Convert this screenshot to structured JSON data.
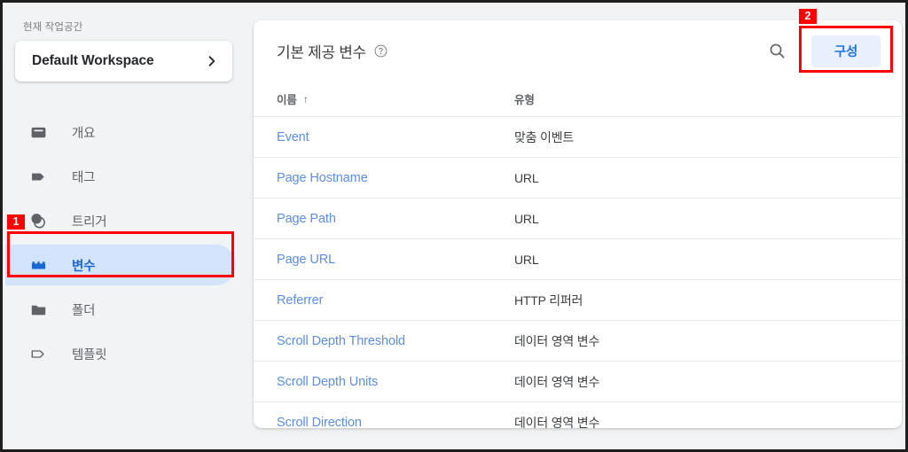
{
  "sidebar": {
    "workspace_label": "현재 작업공간",
    "workspace_name": "Default Workspace",
    "chevron_icon": "chevron-right-icon",
    "items": [
      {
        "label": "개요",
        "icon": "overview-inbox-icon",
        "selected": false
      },
      {
        "label": "태그",
        "icon": "tag-icon",
        "selected": false
      },
      {
        "label": "트리거",
        "icon": "trigger-circles-icon",
        "selected": false
      },
      {
        "label": "변수",
        "icon": "variable-block-icon",
        "selected": true
      },
      {
        "label": "폴더",
        "icon": "folder-icon",
        "selected": false
      },
      {
        "label": "템플릿",
        "icon": "template-tag-outline-icon",
        "selected": false
      }
    ]
  },
  "main": {
    "title": "기본 제공 변수",
    "help_icon": "help-circle-icon",
    "search_icon": "search-icon",
    "configure_label": "구성",
    "columns": {
      "name": "이름",
      "sort_arrow": "↑",
      "type": "유형"
    },
    "rows": [
      {
        "name": "Event",
        "type": "맞춤 이벤트"
      },
      {
        "name": "Page Hostname",
        "type": "URL"
      },
      {
        "name": "Page Path",
        "type": "URL"
      },
      {
        "name": "Page URL",
        "type": "URL"
      },
      {
        "name": "Referrer",
        "type": "HTTP 리퍼러"
      },
      {
        "name": "Scroll Depth Threshold",
        "type": "데이터 영역 변수"
      },
      {
        "name": "Scroll Depth Units",
        "type": "데이터 영역 변수"
      },
      {
        "name": "Scroll Direction",
        "type": "데이터 영역 변수"
      }
    ]
  },
  "annotations": [
    {
      "number": "1",
      "target": "sidebar-item-variables"
    },
    {
      "number": "2",
      "target": "configure-button"
    }
  ],
  "colors": {
    "accent_blue": "#1a73e8",
    "link_blue": "#5a8dee",
    "selected_bg": "#d3e3fc",
    "button_bg": "#e8f0fe",
    "annotation_red": "#ff0000",
    "page_bg": "#f1f3f4"
  }
}
